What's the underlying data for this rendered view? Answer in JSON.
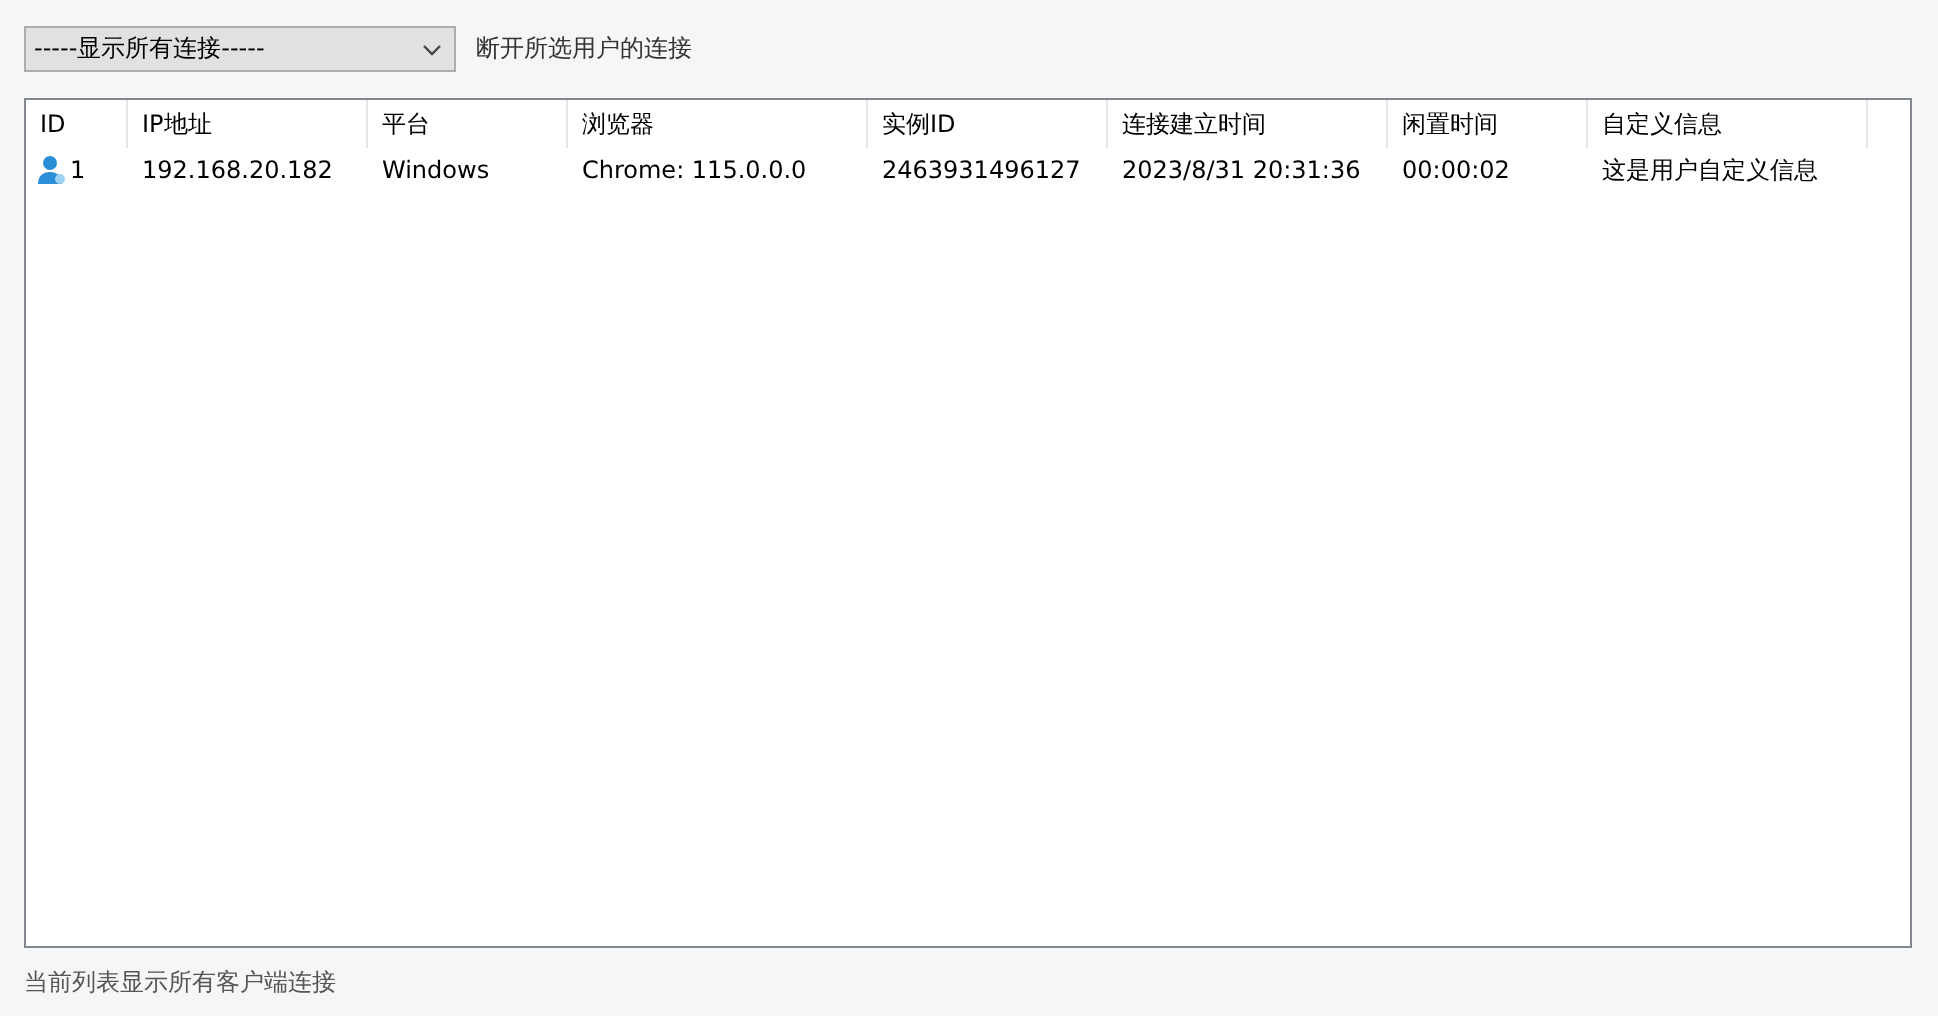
{
  "filter_dropdown": {
    "value": "-----显示所有连接-----"
  },
  "disconnect_link": "断开所选用户的连接",
  "table": {
    "columns": [
      "ID",
      "IP地址",
      "平台",
      "浏览器",
      "实例ID",
      "连接建立时间",
      "闲置时间",
      "自定义信息"
    ],
    "rows": [
      {
        "selected": false,
        "cells": [
          "1",
          "192.168.20.182",
          "Windows",
          "Chrome: 115.0.0.0",
          "2463931496127",
          "2023/8/31 20:31:36",
          "00:00:02",
          "这是用户自定义信息"
        ]
      }
    ]
  },
  "status_text": "当前列表显示所有客户端连接"
}
